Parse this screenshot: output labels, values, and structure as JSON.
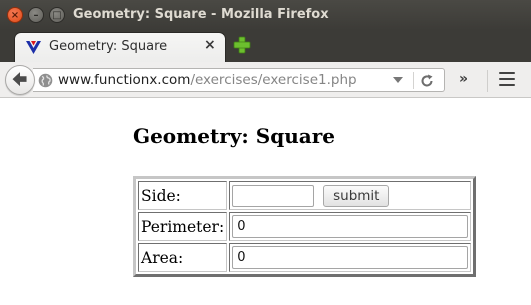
{
  "window": {
    "title": "Geometry: Square - Mozilla Firefox",
    "close_glyph": "×",
    "minimize_glyph": "–",
    "maximize_glyph": "□"
  },
  "tabs": [
    {
      "title": "Geometry: Square",
      "close_glyph": "×",
      "icon": "functionx-favicon"
    }
  ],
  "new_tab_icon": "plus-icon",
  "navbar": {
    "url_host": "www.functionx.com",
    "url_path": "/exercises/exercise1.php",
    "overflow_glyph": "»",
    "icons": [
      "back-arrow-icon",
      "globe-icon",
      "dropdown-icon",
      "reload-icon",
      "hamburger-menu-icon"
    ]
  },
  "page": {
    "heading": "Geometry: Square",
    "form": {
      "side_label": "Side:",
      "side_value": "",
      "submit_label": "submit",
      "perimeter_label": "Perimeter:",
      "perimeter_value": "0",
      "area_label": "Area:",
      "area_value": "0"
    }
  },
  "colors": {
    "titlebar": "#3c3b37",
    "close_button": "#df4a16",
    "plus_icon": "#6cbf2e"
  }
}
